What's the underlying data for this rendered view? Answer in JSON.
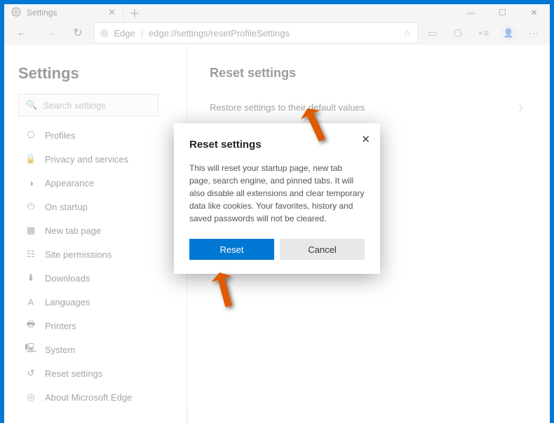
{
  "window": {
    "tab_title": "Settings",
    "address_prefix": "Edge",
    "address": "edge://settings/resetProfileSettings"
  },
  "sidebar": {
    "title": "Settings",
    "search_placeholder": "Search settings",
    "items": [
      {
        "icon": "profile-icon",
        "glyph": "⎔",
        "label": "Profiles"
      },
      {
        "icon": "lock-icon",
        "glyph": "🔒",
        "label": "Privacy and services"
      },
      {
        "icon": "appearance-icon",
        "glyph": "◑",
        "label": "Appearance"
      },
      {
        "icon": "power-icon",
        "glyph": "⏻",
        "label": "On startup"
      },
      {
        "icon": "newtab-icon",
        "glyph": "▦",
        "label": "New tab page"
      },
      {
        "icon": "permissions-icon",
        "glyph": "☷",
        "label": "Site permissions"
      },
      {
        "icon": "download-icon",
        "glyph": "⬇",
        "label": "Downloads"
      },
      {
        "icon": "languages-icon",
        "glyph": "A",
        "label": "Languages"
      },
      {
        "icon": "printer-icon",
        "glyph": "🖶",
        "label": "Printers"
      },
      {
        "icon": "system-icon",
        "glyph": "🖳",
        "label": "System"
      },
      {
        "icon": "reset-icon",
        "glyph": "↺",
        "label": "Reset settings"
      },
      {
        "icon": "about-icon",
        "glyph": "◎",
        "label": "About Microsoft Edge"
      }
    ]
  },
  "main": {
    "title": "Reset settings",
    "row_label": "Restore settings to their default values"
  },
  "dialog": {
    "title": "Reset settings",
    "body": "This will reset your startup page, new tab page, search engine, and pinned tabs. It will also disable all extensions and clear temporary data like cookies. Your favorites, history and saved passwords will not be cleared.",
    "primary": "Reset",
    "secondary": "Cancel"
  }
}
